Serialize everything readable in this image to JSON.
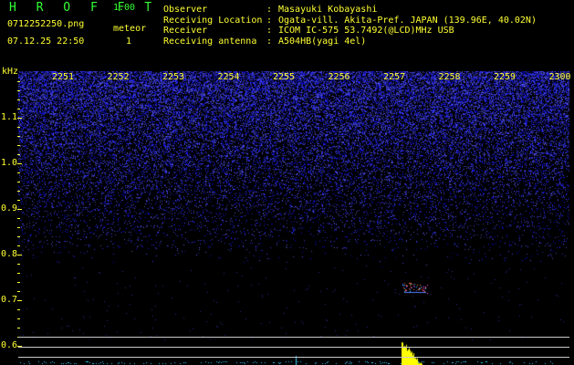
{
  "app": {
    "logo": "H R O F F T",
    "version": "1.00"
  },
  "file": {
    "name": "0712252250.png",
    "timestamp": "07.12.25 22:50"
  },
  "meteor": {
    "label": "meteor",
    "count": "1"
  },
  "info": [
    {
      "key": "Observer",
      "value": "Masayuki Kobayashi"
    },
    {
      "key": "Receiving Location",
      "value": "Ogata-vill. Akita-Pref. JAPAN (139.96E, 40.02N)"
    },
    {
      "key": "Receiver",
      "value": "ICOM IC-575 53.7492(@LCD)MHz USB"
    },
    {
      "key": "Receiving antenna",
      "value": "A504HB(yagi 4el)"
    }
  ],
  "colon": ":",
  "chart_data": {
    "type": "heatmap",
    "ylabel": "kHz",
    "x_ticks": [
      "2251",
      "2252",
      "2253",
      "2254",
      "2255",
      "2256",
      "2257",
      "2258",
      "2259",
      "2300"
    ],
    "y_ticks": [
      "1.1",
      "1.0",
      "0.9",
      "0.8",
      "0.7",
      "0.6"
    ],
    "ylim": [
      0.58,
      1.2
    ],
    "meteor_echo": {
      "time": "2257",
      "frequency_khz": 0.72
    }
  },
  "colors": {
    "label": "#ffff33",
    "logo": "#33ff33",
    "noise": "#2a2aff",
    "echo": "#ff5050",
    "level": "#ffff00",
    "baseline": "#30d0ff"
  }
}
